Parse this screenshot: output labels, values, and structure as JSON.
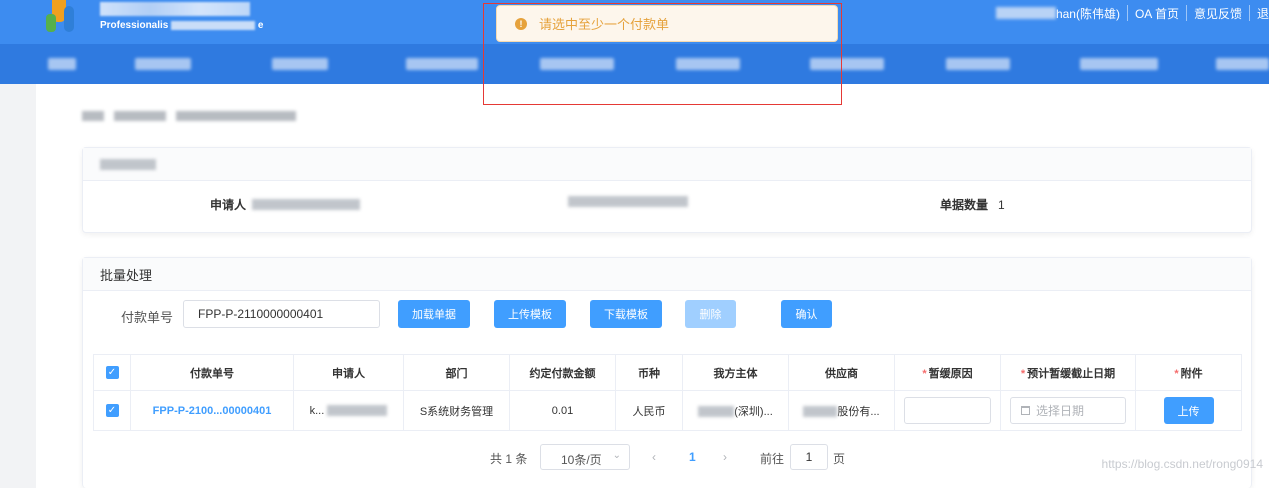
{
  "header": {
    "subtitle": "Professionalis",
    "subtitle_tail": "e",
    "user_suffix": "han(陈伟雄)",
    "links": [
      "OA 首页",
      "意见反馈",
      "退"
    ]
  },
  "toast": {
    "message": "请选中至少一个付款单",
    "type": "warning"
  },
  "summary": {
    "applicant_label": "申请人",
    "count_label": "单据数量",
    "count_value": "1"
  },
  "batch": {
    "title": "批量处理",
    "payment_no_label": "付款单号",
    "payment_no_value": "FPP-P-2110000000401",
    "buttons": [
      "加载单据",
      "上传模板",
      "下载模板",
      "删除",
      "确认"
    ]
  },
  "table": {
    "columns": [
      "付款单号",
      "申请人",
      "部门",
      "约定付款金额",
      "币种",
      "我方主体",
      "供应商",
      "暂缓原因",
      "预计暂缓截止日期",
      "附件"
    ],
    "rows": [
      {
        "payment_no": "FPP-P-2100...00000401",
        "applicant": "k...",
        "department": "S系统财务管理",
        "amount": "0.01",
        "currency": "人民币",
        "our_entity": "(深圳)...",
        "supplier": "股份有...",
        "date_placeholder": "选择日期",
        "upload_label": "上传"
      }
    ]
  },
  "pagination": {
    "total": "共 1 条",
    "page_size": "10条/页",
    "current_page": "1",
    "goto_prefix": "前往",
    "goto_value": "1",
    "goto_suffix": "页"
  },
  "watermark": "https://blog.csdn.net/rong0914",
  "colors": {
    "primary": "#409eff",
    "warning": "#e6a23c",
    "header": "#3d8cf0",
    "highlight_box": "#e53935"
  }
}
